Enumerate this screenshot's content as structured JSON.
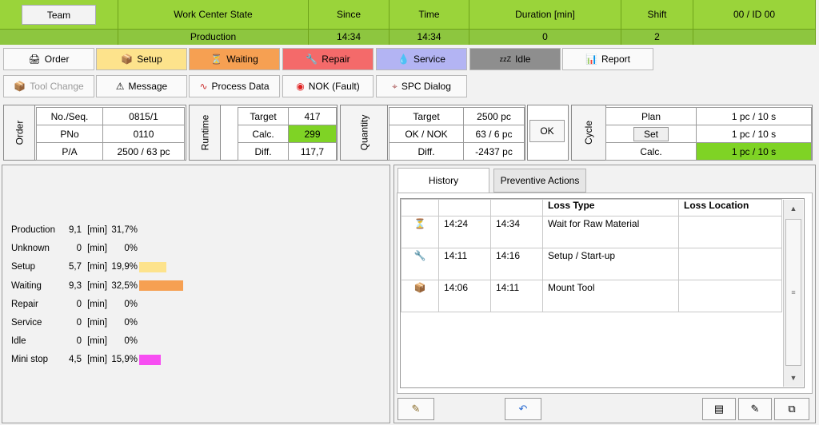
{
  "header": {
    "team_label": "Team",
    "columns": [
      "Work Center State",
      "Since",
      "Time",
      "Duration [min]",
      "Shift",
      "00  / ID 00"
    ],
    "values": [
      "Production",
      "14:34",
      "14:34",
      "0",
      "2",
      ""
    ]
  },
  "toolbar1": [
    {
      "label": "Order",
      "icon": "order-icon",
      "color": "#fafafa"
    },
    {
      "label": "Setup",
      "icon": "setup-icon",
      "color": "#fde38c"
    },
    {
      "label": "Waiting",
      "icon": "waiting-icon",
      "color": "#f6a052"
    },
    {
      "label": "Repair",
      "icon": "repair-icon",
      "color": "#f46a6a"
    },
    {
      "label": "Service",
      "icon": "service-icon",
      "color": "#b3b4f3"
    },
    {
      "label": "Idle",
      "icon": "idle-icon",
      "color": "#8e8e8e"
    },
    {
      "label": "Report",
      "icon": "report-icon",
      "color": "#fafafa"
    }
  ],
  "toolbar2": [
    {
      "label": "Tool Change",
      "icon": "tool-change-icon",
      "enabled": false
    },
    {
      "label": "Message",
      "icon": "warning-icon",
      "enabled": true
    },
    {
      "label": "Process Data",
      "icon": "process-data-icon",
      "enabled": true
    },
    {
      "label": "NOK (Fault)",
      "icon": "fault-icon",
      "enabled": true
    },
    {
      "label": "SPC Dialog",
      "icon": "spc-icon",
      "enabled": true
    }
  ],
  "order": {
    "title": "Order",
    "rows": [
      [
        "No./Seq.",
        "0815/1"
      ],
      [
        "PNo",
        "0110"
      ],
      [
        "P/A",
        "2500  / 63 pc"
      ]
    ]
  },
  "runtime": {
    "title": "Runtime",
    "rows": [
      [
        "Target",
        "417"
      ],
      [
        "Calc.",
        "299"
      ],
      [
        "Diff.",
        "117,7"
      ]
    ]
  },
  "quantity": {
    "title": "Quantity",
    "rows": [
      [
        "Target",
        "2500 pc"
      ],
      [
        "OK / NOK",
        "63  / 6 pc"
      ],
      [
        "Diff.",
        "-2437 pc"
      ]
    ],
    "ok_label": "OK"
  },
  "cycle": {
    "title": "Cycle",
    "rows": [
      [
        "Plan",
        "1 pc  / 10 s"
      ],
      [
        "Set",
        "1 pc  / 10 s"
      ],
      [
        "Calc.",
        "1  pc  / 10 s"
      ]
    ]
  },
  "stats": [
    {
      "label": "Production",
      "value": "9,1",
      "unit": "[min]",
      "pct": "31,7%",
      "fraction": 0,
      "color": ""
    },
    {
      "label": "Unknown",
      "value": "0",
      "unit": "[min]",
      "pct": "0%",
      "fraction": 0,
      "color": ""
    },
    {
      "label": "Setup",
      "value": "5,7",
      "unit": "[min]",
      "pct": "19,9%",
      "fraction": 0.199,
      "color": "#fde38c"
    },
    {
      "label": "Waiting",
      "value": "9,3",
      "unit": "[min]",
      "pct": "32,5%",
      "fraction": 0.325,
      "color": "#f6a052"
    },
    {
      "label": "Repair",
      "value": "0",
      "unit": "[min]",
      "pct": "0%",
      "fraction": 0,
      "color": ""
    },
    {
      "label": "Service",
      "value": "0",
      "unit": "[min]",
      "pct": "0%",
      "fraction": 0,
      "color": ""
    },
    {
      "label": "Idle",
      "value": "0",
      "unit": "[min]",
      "pct": "0%",
      "fraction": 0,
      "color": ""
    },
    {
      "label": "Mini stop",
      "value": "4,5",
      "unit": "[min]",
      "pct": "15,9%",
      "fraction": 0.159,
      "color": "#f74ef2"
    }
  ],
  "tabs": [
    "History",
    "Preventive Actions"
  ],
  "loss_table": {
    "headers": [
      "",
      "",
      "",
      "Loss Type",
      "Loss Location"
    ],
    "rows": [
      {
        "icon": "waiting-icon",
        "start": "14:24",
        "end": "14:34",
        "type": "Wait for Raw Material",
        "location": ""
      },
      {
        "icon": "setup-wrench-icon",
        "start": "14:11",
        "end": "14:16",
        "type": "Setup / Start-up",
        "location": ""
      },
      {
        "icon": "mount-tool-icon",
        "start": "14:06",
        "end": "14:11",
        "type": "Mount Tool",
        "location": ""
      }
    ]
  }
}
